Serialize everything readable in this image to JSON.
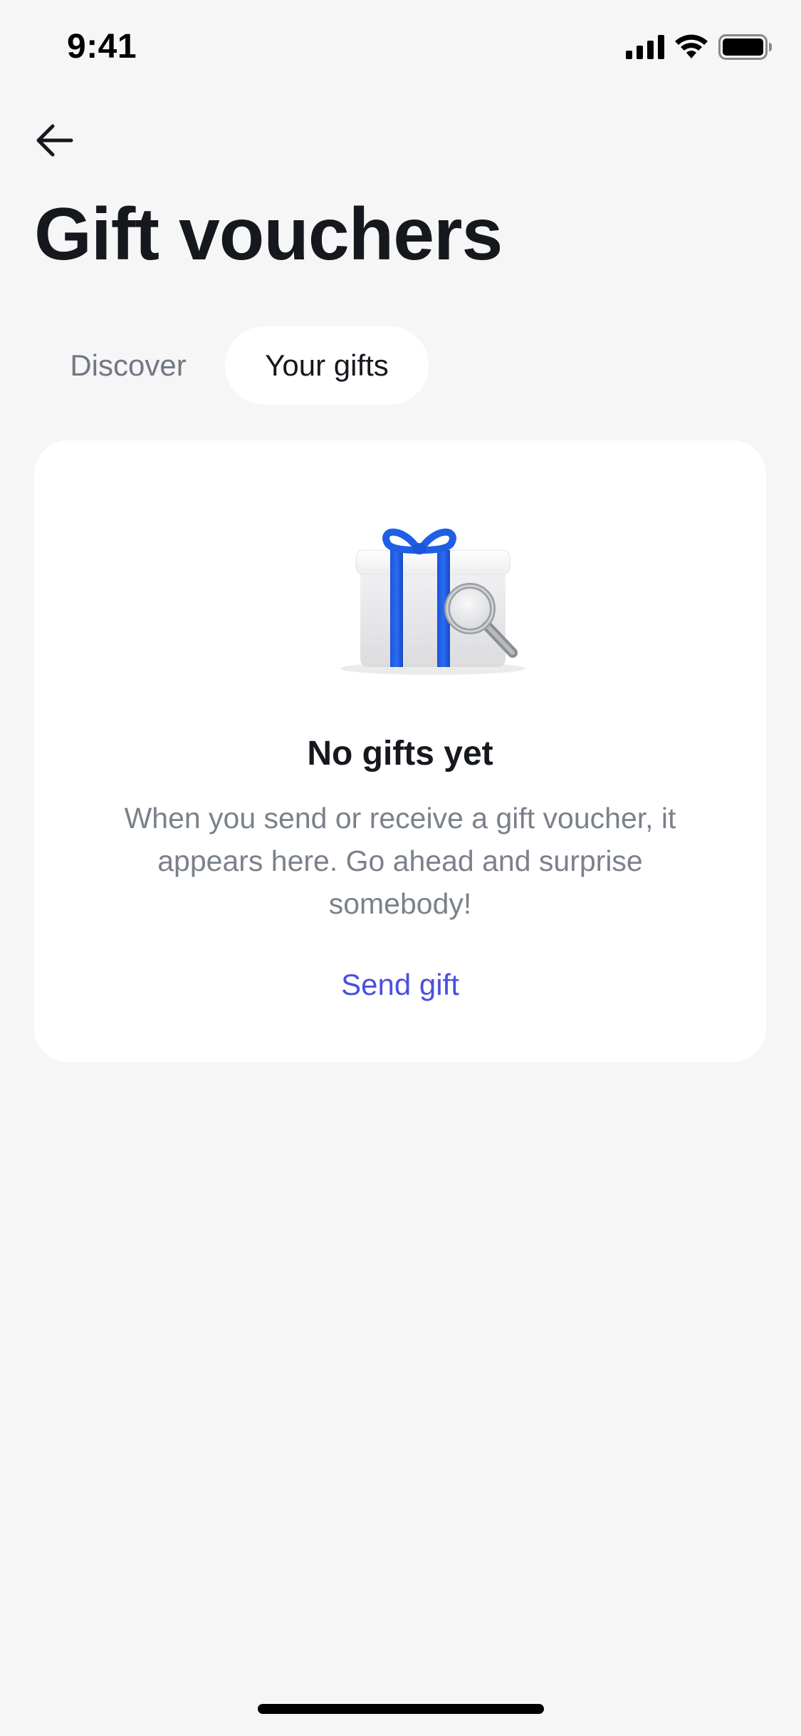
{
  "status_bar": {
    "time": "9:41",
    "icons": [
      "cellular-signal-icon",
      "wifi-icon",
      "battery-icon"
    ]
  },
  "header": {
    "back_icon": "arrow-left-icon",
    "title": "Gift vouchers"
  },
  "tabs": [
    {
      "label": "Discover",
      "selected": false
    },
    {
      "label": "Your gifts",
      "selected": true
    }
  ],
  "empty_state": {
    "illustration": "gift-box-magnifier-icon",
    "title": "No gifts yet",
    "description": "When you send or receive a gift voucher, it appears here. Go ahead and surprise somebody!",
    "action_label": "Send gift"
  },
  "colors": {
    "background": "#f6f6f6",
    "card": "#ffffff",
    "text_primary": "#15181d",
    "text_secondary": "#7b818b",
    "accent": "#4a50de",
    "ribbon": "#1f5fe6"
  }
}
